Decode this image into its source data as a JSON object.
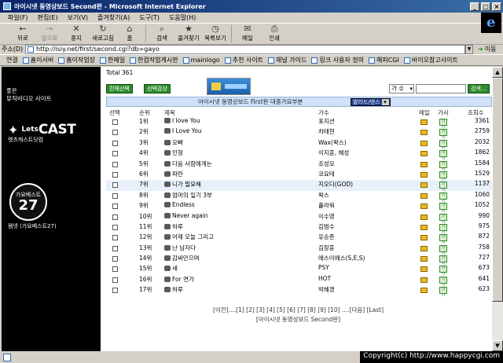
{
  "window": {
    "title": "아이시넷 동영상보드 Second판 - Microsoft Internet Explorer",
    "buttons": [
      "_",
      "□",
      "×"
    ]
  },
  "menu": [
    "파일(F)",
    "편집(E)",
    "보기(V)",
    "즐겨찾기(A)",
    "도구(T)",
    "도움말(H)"
  ],
  "toolbar": [
    {
      "label": "뒤로",
      "icon": "←",
      "disabled": false
    },
    {
      "label": "앞으로",
      "icon": "→",
      "disabled": true
    },
    {
      "label": "중지",
      "icon": "✕",
      "disabled": false
    },
    {
      "label": "새로고침",
      "icon": "↻",
      "disabled": false
    },
    {
      "label": "홈",
      "icon": "⌂",
      "disabled": false
    },
    {
      "label": "검색",
      "icon": "⌕",
      "disabled": false
    },
    {
      "label": "즐겨찾기",
      "icon": "★",
      "disabled": false
    },
    {
      "label": "목록보기",
      "icon": "◷",
      "disabled": false
    },
    {
      "label": "메일",
      "icon": "✉",
      "disabled": false
    },
    {
      "label": "인쇄",
      "icon": "⎙",
      "disabled": false
    }
  ],
  "address": {
    "label": "주소(D)",
    "url": "http://isiy.net/first/second.cgi?db=gayo",
    "go": "이동"
  },
  "links": {
    "label": "연결",
    "items": [
      "홈이서버",
      "홈이작업장",
      "한메일",
      "한컴작업게시판",
      "mainlogo",
      "추천 사이트",
      "채널 가이드",
      "링크 사용자 정의",
      "해피CGI",
      "바이오참고사이트"
    ]
  },
  "sidebar": {
    "top_line1": "좋은",
    "top_line2": "뮤직비디오 사이트",
    "lets": "Lets",
    "cast": "CAST",
    "lets_sub": "렛츠캐스트닷컴",
    "badge_top": "가요베스트",
    "badge_num": "27",
    "badge_caption": "렘넷 (가요베스트27)"
  },
  "main": {
    "total": "Total 361",
    "btn_select_all": "전체선택",
    "btn_listen_selected": "선택감상",
    "search_field": "가 수",
    "search_button": "검색...",
    "board_title": "아이시넷 동영상보드 First판 대중가요부분",
    "genre": "발라드/댄스",
    "headers": {
      "select": "선택",
      "rank": "순위",
      "title": "제목",
      "artist": "가수",
      "mail": "메일",
      "lyrics": "가사",
      "views": "조회수"
    },
    "lyrics_icon": "가사",
    "rows": [
      {
        "rank": "1위",
        "title": "I love You",
        "artist": "포지션",
        "views": "3361"
      },
      {
        "rank": "2위",
        "title": "I Love You",
        "artist": "차태현",
        "views": "2759"
      },
      {
        "rank": "3위",
        "title": "오빠",
        "artist": "Wax(왁스)",
        "views": "2032"
      },
      {
        "rank": "4위",
        "title": "인형",
        "artist": "이지훈, 혜성",
        "views": "1862"
      },
      {
        "rank": "5위",
        "title": "다음 사람에게는",
        "artist": "조성모",
        "views": "1584"
      },
      {
        "rank": "6위",
        "title": "파란",
        "artist": "코요테",
        "views": "1529"
      },
      {
        "rank": "7위",
        "title": "니가 필요해",
        "artist": "지오디(GOD)",
        "views": "1137"
      },
      {
        "rank": "8위",
        "title": "엄마의 일기 3부",
        "artist": "왁스",
        "views": "1060"
      },
      {
        "rank": "9위",
        "title": "Endless",
        "artist": "플라워",
        "views": "1052"
      },
      {
        "rank": "10위",
        "title": "Never again",
        "artist": "이수영",
        "views": "990"
      },
      {
        "rank": "11위",
        "title": "하루",
        "artist": "김범수",
        "views": "975"
      },
      {
        "rank": "12위",
        "title": "어제 오늘 그리고",
        "artist": "유승준",
        "views": "872"
      },
      {
        "rank": "13위",
        "title": "난 남자다",
        "artist": "김장훈",
        "views": "758"
      },
      {
        "rank": "14위",
        "title": "감싸안으며",
        "artist": "에스이에스(S,E,S)",
        "views": "727"
      },
      {
        "rank": "15위",
        "title": "새",
        "artist": "PSY",
        "views": "673"
      },
      {
        "rank": "16위",
        "title": "For 연가",
        "artist": "HOT",
        "views": "641"
      },
      {
        "rank": "17위",
        "title": "하루",
        "artist": "박혜경",
        "views": "623"
      }
    ],
    "pager": "[이전]....[1] [2] [3] [4] [5] [6] [7] [8] [9] [10] ....[다음] [Last]",
    "second_link": "[아이시넷 동영상보드 Second판]"
  },
  "status": {
    "copyright": "Copyright(c) http://www.happycgi.com"
  }
}
